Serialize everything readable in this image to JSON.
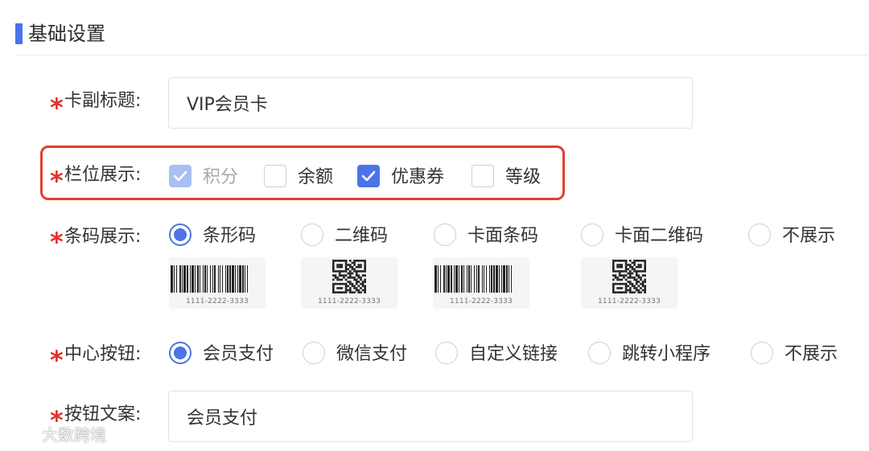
{
  "section": {
    "title": "基础设置"
  },
  "card_subtitle": {
    "label": "卡副标题:",
    "value": "VIP会员卡"
  },
  "fields": {
    "label": "栏位展示:",
    "options": [
      {
        "label": "积分",
        "checked": true,
        "disabled": true
      },
      {
        "label": "余额",
        "checked": false,
        "disabled": false
      },
      {
        "label": "优惠券",
        "checked": true,
        "disabled": false
      },
      {
        "label": "等级",
        "checked": false,
        "disabled": false
      }
    ]
  },
  "barcode": {
    "label": "条码展示:",
    "options": [
      "条形码",
      "二维码",
      "卡面条码",
      "卡面二维码",
      "不展示"
    ],
    "selected": "条形码",
    "previews": [
      {
        "kind": "barcode-icon",
        "number": "1111-2222-3333"
      },
      {
        "kind": "qrcode-icon",
        "number": "1111-2222-3333"
      },
      {
        "kind": "barcode-icon",
        "number": "1111-2222-3333"
      },
      {
        "kind": "qrcode-icon",
        "number": "1111-2222-3333"
      }
    ]
  },
  "center_button": {
    "label": "中心按钮:",
    "options": [
      "会员支付",
      "微信支付",
      "自定义链接",
      "跳转小程序",
      "不展示"
    ],
    "selected": "会员支付"
  },
  "button_text": {
    "label": "按钮文案:",
    "value": "会员支付"
  },
  "watermark": {
    "text": "大数跨境"
  },
  "colors": {
    "accent": "#4a74e8",
    "required_star": "#e2312c",
    "highlight": "#e0402d"
  }
}
